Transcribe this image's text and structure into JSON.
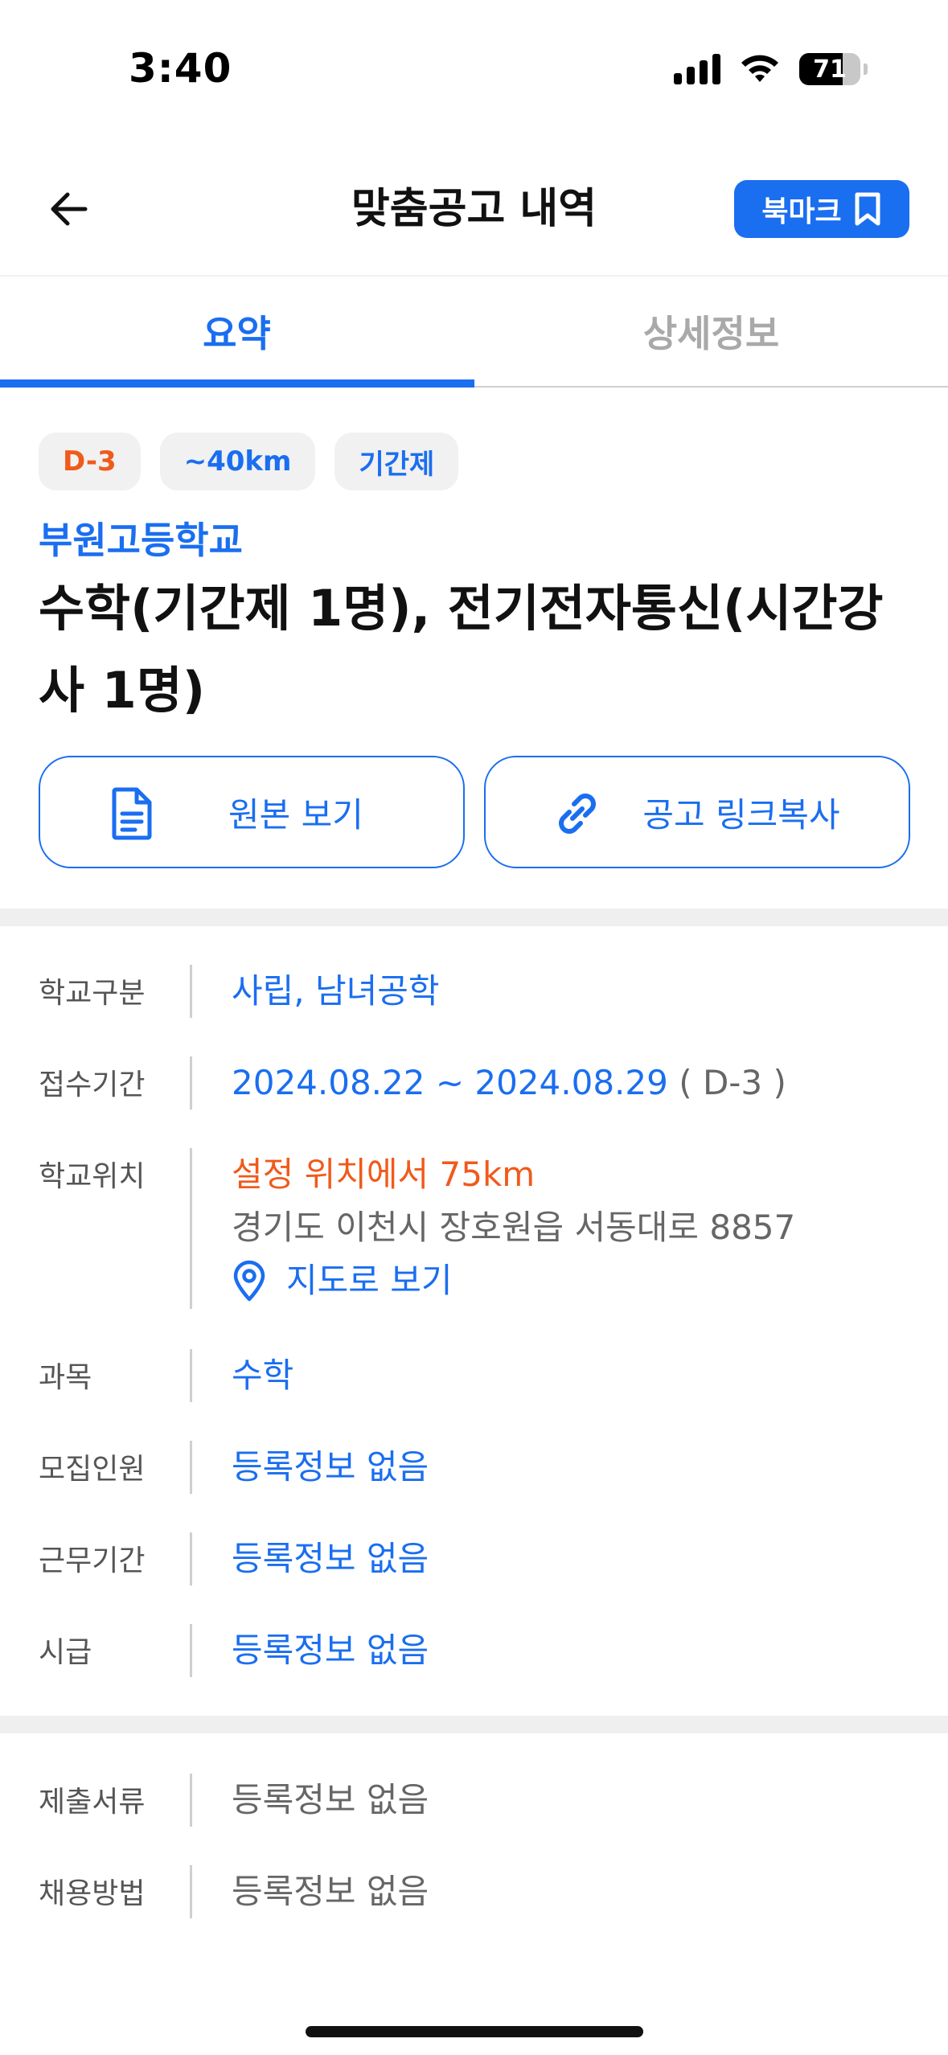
{
  "status_bar": {
    "time": "3:40",
    "battery_level": 71,
    "battery_text": "71",
    "icons": [
      "signal-icon",
      "wifi-icon",
      "battery-icon"
    ]
  },
  "header": {
    "title": "맞춤공고 내역",
    "bookmark_label": "북마크",
    "back_icon": "arrow-left-icon",
    "bookmark_icon": "bookmark-icon"
  },
  "tabs": [
    {
      "label": "요약",
      "active": true
    },
    {
      "label": "상세정보",
      "active": false
    }
  ],
  "summary": {
    "chips": [
      "D-3",
      "~40km",
      "기간제"
    ],
    "school": "부원고등학교",
    "title": "수학(기간제 1명), 전기전자통신(시간강사 1명)",
    "buttons": [
      {
        "label": "원본 보기",
        "icon": "document-icon"
      },
      {
        "label": "공고 링크복사",
        "icon": "link-icon"
      }
    ]
  },
  "info": {
    "school_type": {
      "label": "학교구분",
      "value": "사립, 남녀공학"
    },
    "period": {
      "label": "접수기간",
      "value": "2024.08.22 ~ 2024.08.29",
      "dday": "( D-3 )"
    },
    "location": {
      "label": "학교위치",
      "distance": "설정 위치에서 75km",
      "address": "경기도 이천시 장호원읍 서동대로 8857",
      "map_link": "지도로 보기"
    },
    "subject": {
      "label": "과목",
      "value": "수학"
    },
    "recruit": {
      "label": "모집인원",
      "value": "등록정보 없음"
    },
    "work_period": {
      "label": "근무기간",
      "value": "등록정보 없음"
    },
    "wage": {
      "label": "시급",
      "value": "등록정보 없음"
    }
  },
  "info2": {
    "documents": {
      "label": "제출서류",
      "value": "등록정보 없음"
    },
    "method": {
      "label": "채용방법",
      "value": "등록정보 없음"
    }
  },
  "colors": {
    "accent": "#1a6ef0",
    "dday": "#f05a1a",
    "muted": "#666666"
  }
}
